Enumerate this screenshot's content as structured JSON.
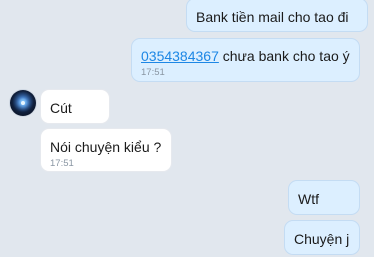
{
  "messages": [
    {
      "id": "m1",
      "side": "mine",
      "text": "Bank tiền mail cho tao đi",
      "time": ""
    },
    {
      "id": "m2",
      "side": "mine",
      "link": "0354384367",
      "text": " chưa bank cho tao ý",
      "time": "17:51"
    },
    {
      "id": "m3",
      "side": "theirs",
      "text": "Cút",
      "time": ""
    },
    {
      "id": "m4",
      "side": "theirs",
      "text": "Nói chuyện kiểu ?",
      "time": "17:51"
    },
    {
      "id": "m5",
      "side": "mine",
      "text": "Wtf",
      "time": ""
    },
    {
      "id": "m6",
      "side": "mine",
      "text": "Chuyện j",
      "time": ""
    }
  ],
  "avatar_icon": "contact-avatar"
}
